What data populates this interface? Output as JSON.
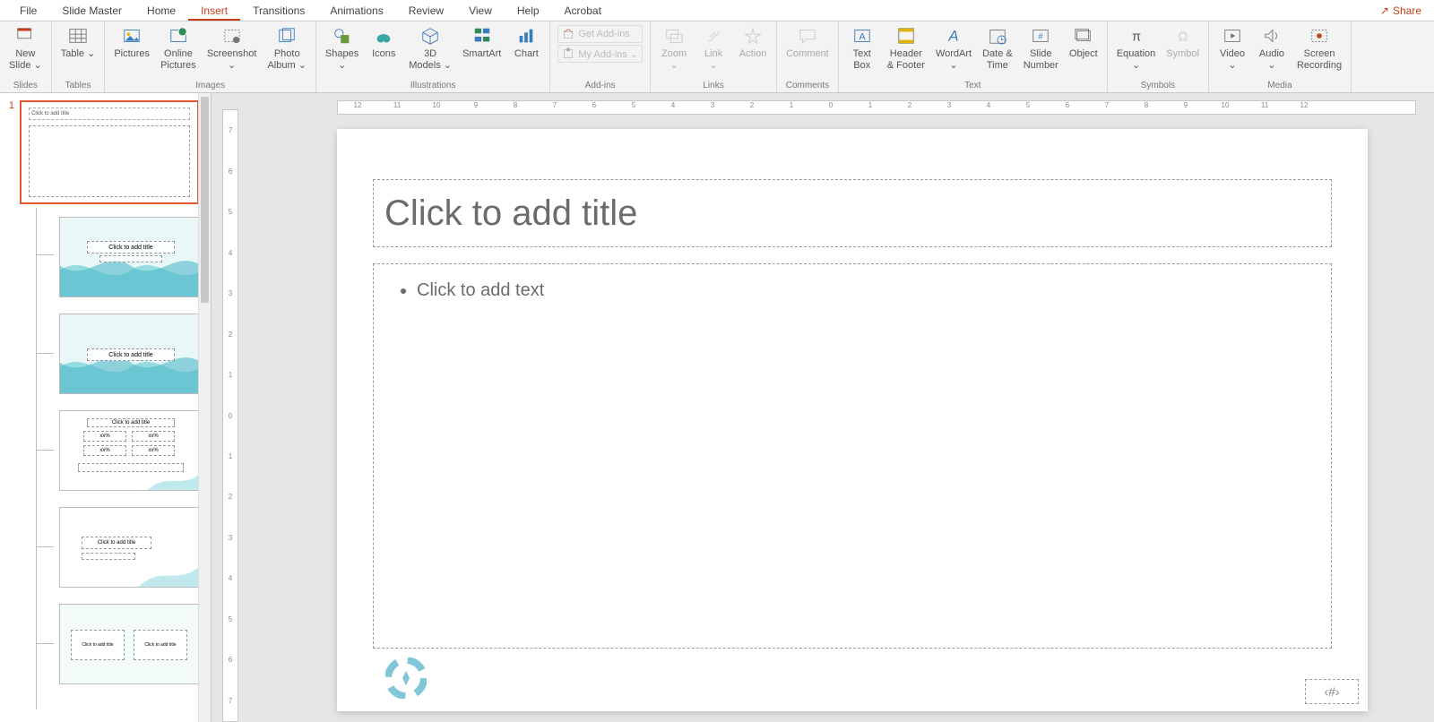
{
  "menubar": {
    "items": [
      "File",
      "Slide Master",
      "Home",
      "Insert",
      "Transitions",
      "Animations",
      "Review",
      "View",
      "Help",
      "Acrobat"
    ],
    "active": "Insert",
    "share": "Share"
  },
  "ribbon": {
    "groups": {
      "slides": {
        "label": "Slides",
        "new_slide": "New\nSlide ⌄"
      },
      "tables": {
        "label": "Tables",
        "table": "Table ⌄"
      },
      "images": {
        "label": "Images",
        "pictures": "Pictures",
        "online": "Online\nPictures",
        "screenshot": "Screenshot\n⌄",
        "album": "Photo\nAlbum ⌄"
      },
      "illustrations": {
        "label": "Illustrations",
        "shapes": "Shapes\n⌄",
        "icons": "Icons",
        "models": "3D\nModels ⌄",
        "smartart": "SmartArt",
        "chart": "Chart"
      },
      "addins": {
        "label": "Add-ins",
        "get": "Get Add-ins",
        "my": "My Add-ins  ⌄"
      },
      "links": {
        "label": "Links",
        "zoom": "Zoom\n⌄",
        "link": "Link\n⌄",
        "action": "Action"
      },
      "comments": {
        "label": "Comments",
        "comment": "Comment"
      },
      "text": {
        "label": "Text",
        "textbox": "Text\nBox",
        "header": "Header\n& Footer",
        "wordart": "WordArt\n⌄",
        "datetime": "Date &\nTime",
        "slidenum": "Slide\nNumber",
        "object": "Object"
      },
      "symbols": {
        "label": "Symbols",
        "equation": "Equation\n⌄",
        "symbol": "Symbol"
      },
      "media": {
        "label": "Media",
        "video": "Video\n⌄",
        "audio": "Audio\n⌄",
        "recording": "Screen\nRecording"
      }
    }
  },
  "slidepanel": {
    "slide_number": "1",
    "master_title": "Click to add title",
    "layout_title": "Click to add title",
    "xx": "xx%"
  },
  "canvas": {
    "title_placeholder": "Click to add title",
    "body_placeholder": "Click to add text",
    "page_number_placeholder": "‹#›"
  },
  "ruler": {
    "h": [
      "12",
      "11",
      "10",
      "9",
      "8",
      "7",
      "6",
      "5",
      "4",
      "3",
      "2",
      "1",
      "0",
      "1",
      "2",
      "3",
      "4",
      "5",
      "6",
      "7",
      "8",
      "9",
      "10",
      "11",
      "12"
    ],
    "v": [
      "7",
      "6",
      "5",
      "4",
      "3",
      "2",
      "1",
      "0",
      "1",
      "2",
      "3",
      "4",
      "5",
      "6",
      "7"
    ]
  }
}
